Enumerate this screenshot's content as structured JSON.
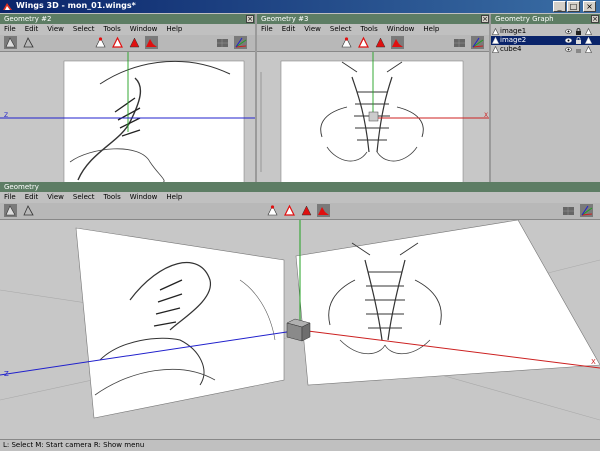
{
  "window": {
    "title": "Wings 3D - mon_01.wings*"
  },
  "panes": {
    "geom2": {
      "title": "Geometry #2"
    },
    "geom3": {
      "title": "Geometry #3"
    },
    "graph": {
      "title": "Geometry Graph"
    },
    "main": {
      "title": "Geometry"
    }
  },
  "menu": [
    "File",
    "Edit",
    "View",
    "Select",
    "Tools",
    "Window",
    "Help"
  ],
  "outliner": {
    "items": [
      {
        "name": "image1"
      },
      {
        "name": "image2"
      },
      {
        "name": "cube4"
      }
    ]
  },
  "axis_labels": {
    "x": "X",
    "z": "Z"
  },
  "status": {
    "text": "L: Select   M: Start camera   R: Show menu"
  },
  "colors": {
    "title_bar": "#0a246a",
    "pane_header": "#5d7d64",
    "selection_mode": "#e01010",
    "x_axis": "#cc2020",
    "y_axis": "#20a020",
    "z_axis": "#2020cc"
  }
}
